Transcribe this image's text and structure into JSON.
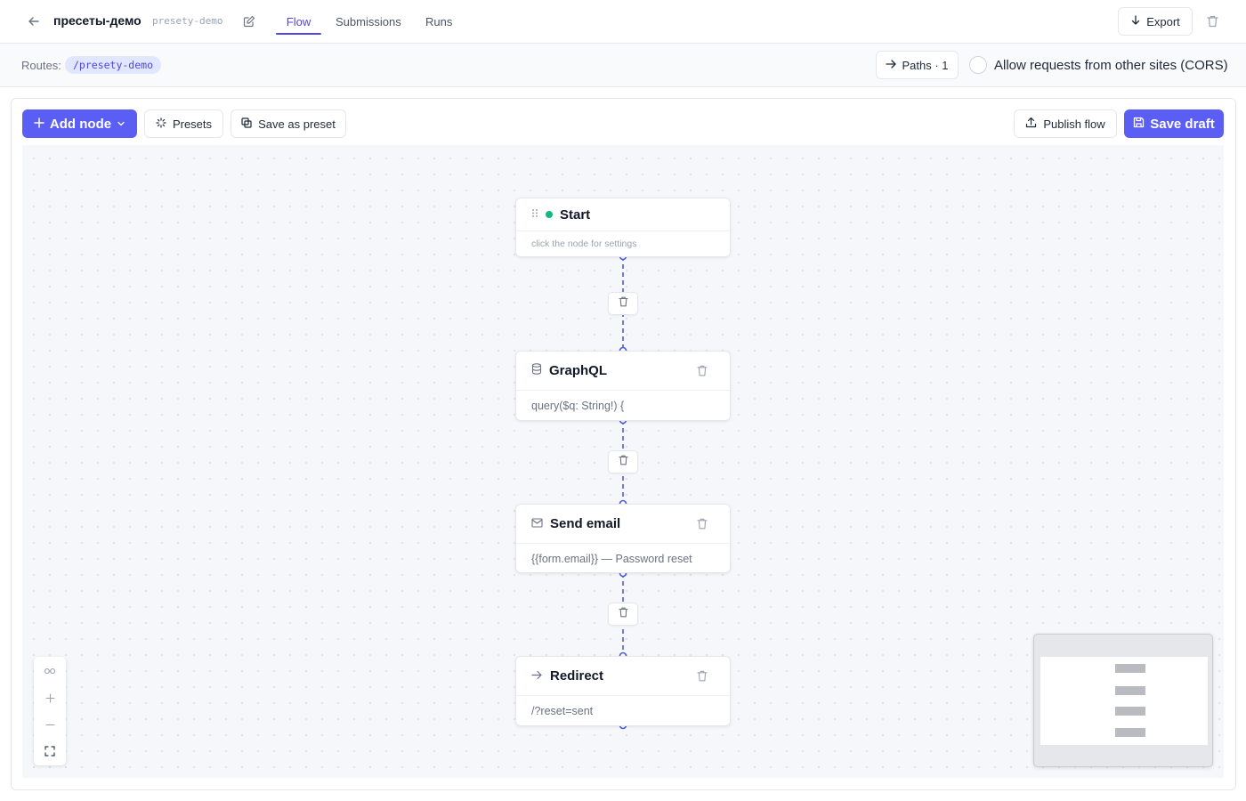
{
  "header": {
    "title": "пресеты-демо",
    "slug": "presety-demo",
    "tabs": [
      {
        "label": "Flow",
        "active": true
      },
      {
        "label": "Submissions",
        "active": false
      },
      {
        "label": "Runs",
        "active": false
      }
    ],
    "export_label": "Export"
  },
  "routes": {
    "label": "Routes:",
    "route": "/presety-demo",
    "paths_label": "Paths · 1",
    "cors_label": "Allow requests from other sites (CORS)",
    "cors_checked": false
  },
  "toolbar": {
    "add_node_label": "Add node",
    "presets_label": "Presets",
    "save_as_preset_label": "Save as preset",
    "publish_label": "Publish flow",
    "save_draft_label": "Save draft"
  },
  "nodes": [
    {
      "title": "Start",
      "subtitle": "click the node for settings",
      "icon": "drag-handle-icon"
    },
    {
      "title": "GraphQL",
      "subtitle": "query($q: String!) {",
      "icon": "database-icon"
    },
    {
      "title": "Send email",
      "subtitle": "{{form.email}} — Password reset",
      "icon": "mail-icon"
    },
    {
      "title": "Redirect",
      "subtitle": "/?reset=sent",
      "icon": "arrow-right-icon"
    }
  ],
  "colors": {
    "accent": "#5b5ef4",
    "tab_active": "#4f46e5",
    "start_dot": "#10b981",
    "edge": "#4f5bd5"
  }
}
